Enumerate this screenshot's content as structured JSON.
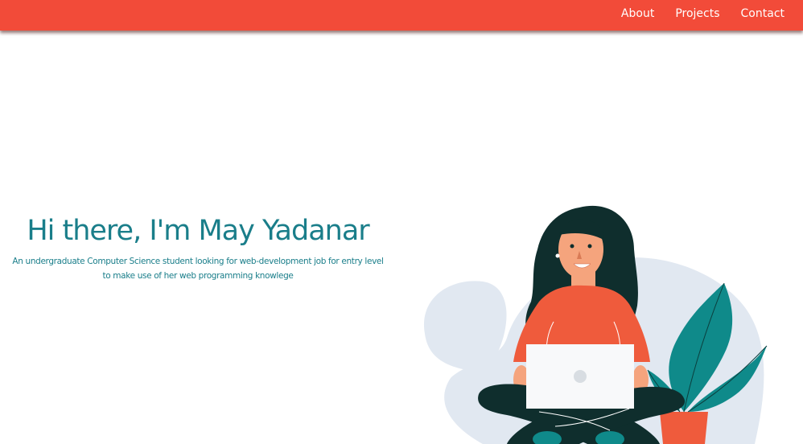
{
  "nav": {
    "links": [
      "About",
      "Projects",
      "Contact"
    ]
  },
  "hero": {
    "title": "Hi there, I'm May Yadanar",
    "subtitle": "An undergraduate Computer Science student looking for web-development job for entry level to make use of her web programming knowlege"
  },
  "colors": {
    "navbar": "#f24b39",
    "accent_text": "#1a7e8a",
    "shirt": "#ef5b3c",
    "hair": "#0f2e2d",
    "skin": "#f5a47d",
    "leaf": "#0f8a8a",
    "background_blob": "#e1e8f1"
  },
  "illustration": {
    "icon": "woman-with-laptop-illustration"
  }
}
